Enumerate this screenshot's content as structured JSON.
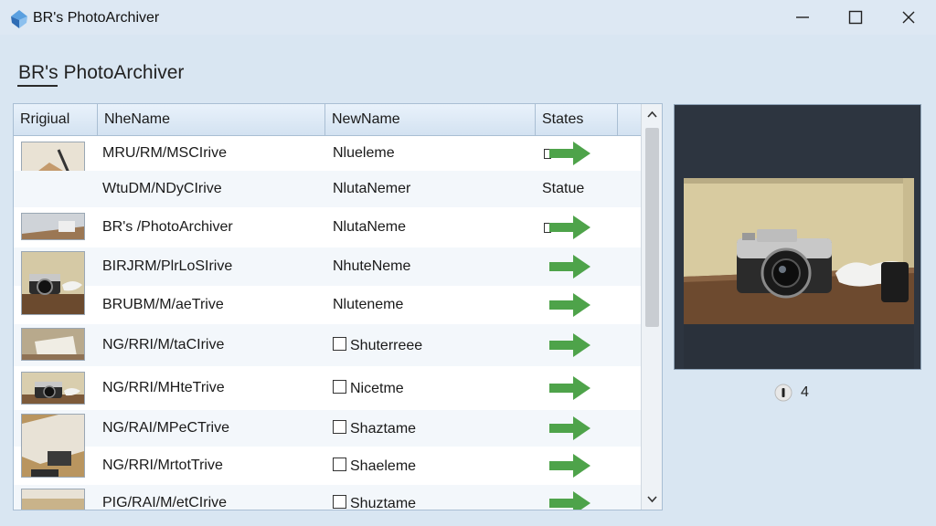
{
  "window": {
    "title": "BR's PhotoArchiver"
  },
  "header": {
    "title": "BR's PhotoArchiver"
  },
  "table": {
    "columns": [
      "Rrigiual",
      "NheName",
      "NewName",
      "States"
    ],
    "rows": [
      {
        "original": "MRU/RM/MSCIrive",
        "new_name": "Nlueleme",
        "status": "",
        "checkbox": false,
        "arrow": true,
        "small_box": true,
        "thumb": "boxes"
      },
      {
        "original": "WtuDM/NDyCIrive",
        "new_name": "NlutaNemer",
        "status": "Statue",
        "checkbox": false,
        "arrow": false,
        "small_box": false,
        "thumb": ""
      },
      {
        "original": "BR's /PhotoArchiver",
        "new_name": "NlutaNeme",
        "status": "",
        "checkbox": false,
        "arrow": true,
        "small_box": true,
        "thumb": "table"
      },
      {
        "original": "BIRJRM/PlrLoSIrive",
        "new_name": "NhuteNeme",
        "status": "",
        "checkbox": false,
        "arrow": true,
        "small_box": false,
        "thumb": "camera"
      },
      {
        "original": "BRUBM/M/aeTrive",
        "new_name": "Nluteneme",
        "status": "",
        "checkbox": false,
        "arrow": true,
        "small_box": false,
        "thumb": ""
      },
      {
        "original": "NG/RRI/M/taCIrive",
        "new_name": "Shuterreee",
        "status": "",
        "checkbox": true,
        "arrow": true,
        "small_box": false,
        "thumb": "paper"
      },
      {
        "original": "NG/RRI/MHteTrive",
        "new_name": "Nicetme",
        "status": "",
        "checkbox": true,
        "arrow": true,
        "small_box": false,
        "thumb": "camera2"
      },
      {
        "original": "NG/RAI/MPeCTrive",
        "new_name": "Shaztame",
        "status": "",
        "checkbox": true,
        "arrow": true,
        "small_box": false,
        "thumb": "desk"
      },
      {
        "original": "NG/RRI/MrtotTrive",
        "new_name": "Shaeleme",
        "status": "",
        "checkbox": true,
        "arrow": true,
        "small_box": false,
        "thumb": ""
      },
      {
        "original": "PIG/RAI/M/etCIrive",
        "new_name": "Shuztame",
        "status": "",
        "checkbox": true,
        "arrow": true,
        "small_box": false,
        "thumb": "desk2"
      }
    ]
  },
  "preview": {
    "counter": "4"
  },
  "colors": {
    "arrow": "#4ea34a",
    "accent": "#2f6db5"
  }
}
